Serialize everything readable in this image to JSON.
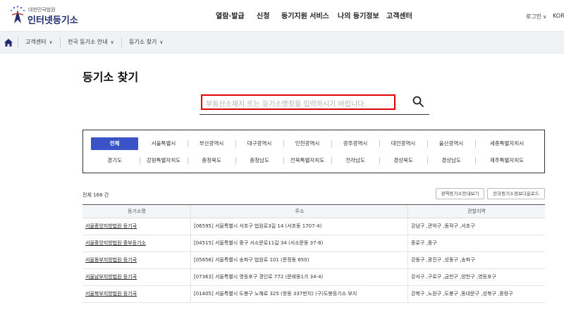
{
  "header": {
    "logo_small": "대한민국법원",
    "logo_big": "인터넷등기소",
    "nav": [
      "열람·발급",
      "신청",
      "등기지원 서비스",
      "나의 등기정보",
      "고객센터"
    ],
    "login_label": "로그인",
    "lang_label": "KOR"
  },
  "breadcrumb": {
    "items": [
      "고객센터",
      "전국 등기소 안내",
      "등기소 찾기"
    ]
  },
  "page_title": "등기소 찾기",
  "search": {
    "placeholder": "부동산소재지 또는 등기소명칭을 입력하시기 바랍니다.",
    "value": ""
  },
  "regions": {
    "row1": [
      "전체",
      "서울특별시",
      "부산광역시",
      "대구광역시",
      "인천광역시",
      "광주광역시",
      "대전광역시",
      "울산광역시",
      "세종특별자치시"
    ],
    "row2": [
      "경기도",
      "강원특별자치도",
      "충청북도",
      "충청남도",
      "전북특별자치도",
      "전라남도",
      "경상북도",
      "경상남도",
      "제주특별자치도"
    ],
    "active": "전체",
    "accent_color": "#3b53c6"
  },
  "list": {
    "total": "전체 168 건",
    "btn_regional": "광역등기소안내보기",
    "btn_download": "전국등기소정보다운로드"
  },
  "table": {
    "headers": [
      "등기소명",
      "주소",
      "관할지역"
    ],
    "rows": [
      [
        "서울중앙지방법원 등기국",
        "[06595] 서울특별시 서초구 법원로3길 14 (서초동 1707-4)",
        "강남구 ,관악구 ,동작구 ,서초구"
      ],
      [
        "서울중앙지방법원 중부등기소",
        "[04515] 서울특별시 중구 서소문로11길 34 (서소문동 37-8)",
        "종로구 ,중구"
      ],
      [
        "서울동부지방법원 등기국",
        "[05856] 서울특별시 송파구 법원로 101 (문정동 650)",
        "강동구 ,광진구 ,성동구 ,송파구"
      ],
      [
        "서울남부지방법원 등기국",
        "[07363] 서울특별시 영등포구 경인로 772 (문래동1가 34-4)",
        "강서구 ,구로구 ,금천구 ,양천구 ,영등포구"
      ],
      [
        "서울북부지방법원 등기국",
        "[01405] 서울특별시 도봉구 노해로 325 (창동 337번지) (구)도봉등기소 부지",
        "강북구 ,노원구 ,도봉구 ,동대문구 ,성북구 ,중랑구"
      ]
    ]
  }
}
